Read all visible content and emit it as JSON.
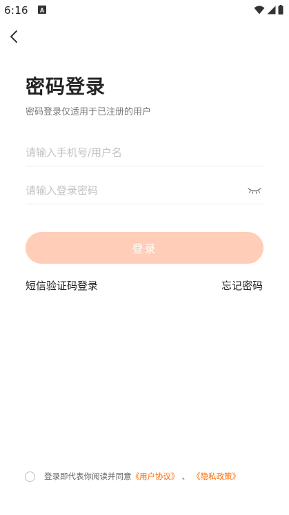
{
  "status_bar": {
    "time": "6:16",
    "app_icon": "notification-a-icon",
    "icons": [
      "wifi-icon",
      "cellular-signal-icon",
      "battery-icon"
    ]
  },
  "nav": {
    "back_icon": "chevron-left-icon"
  },
  "header": {
    "title": "密码登录",
    "subtitle": "密码登录仅适用于已注册的用户"
  },
  "form": {
    "phone_placeholder": "请输入手机号/用户名",
    "phone_value": "",
    "password_placeholder": "请输入登录密码",
    "password_value": "",
    "password_toggle_icon": "eye-closed-icon"
  },
  "actions": {
    "login_label": "登录",
    "sms_login_label": "短信验证码登录",
    "forgot_password_label": "忘记密码"
  },
  "agreement": {
    "checked": false,
    "text": "登录即代表你阅读并同意",
    "user_agreement": "《用户协议》",
    "separator": "、",
    "privacy_policy": "《隐私政策》"
  },
  "colors": {
    "accent": "#ff6a00",
    "button_disabled": "#ffcdb8",
    "text_primary": "#222222",
    "placeholder": "#c2c2c2"
  }
}
